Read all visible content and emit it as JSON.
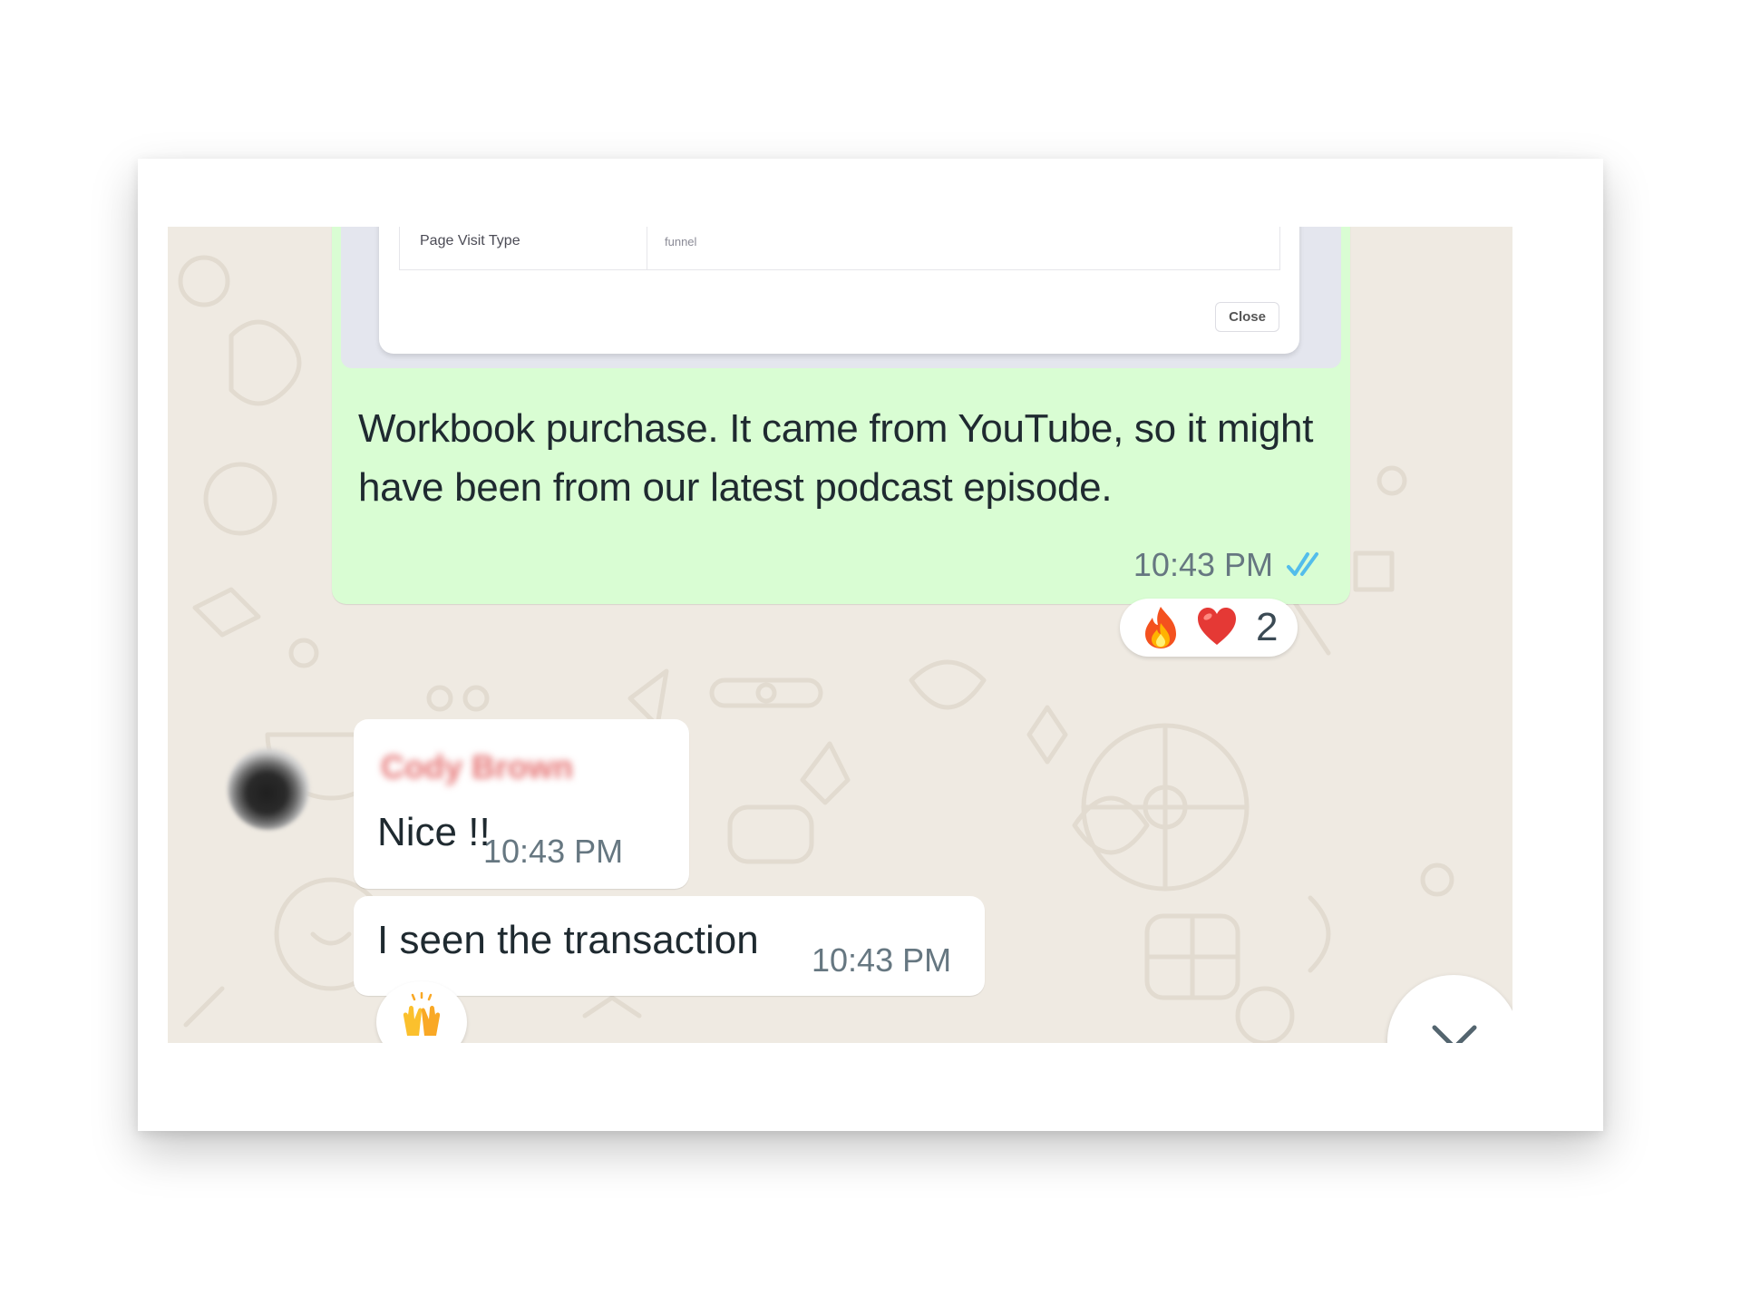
{
  "preview": {
    "row_label": "Page Visit Type",
    "row_value": "funnel",
    "close_label": "Close"
  },
  "outgoing": {
    "text": "Workbook purchase. It came from YouTube, so it might have been from our latest podcast episode.",
    "time": "10:43 PM",
    "status_icon": "double-check-icon",
    "reactions": {
      "emojis": [
        "fire-emoji",
        "red-heart-emoji"
      ],
      "count": "2"
    }
  },
  "incoming": {
    "sender": "Cody Brown",
    "messages": [
      {
        "text": "Nice !!",
        "time": "10:43 PM"
      },
      {
        "text": "I seen the transaction",
        "time": "10:43 PM",
        "reaction": "raising-hands-emoji"
      }
    ]
  },
  "scroll_button_icon": "chevron-down-icon",
  "colors": {
    "chat_background": "#efeae2",
    "outgoing_bubble": "#d9fdd3",
    "incoming_bubble": "#ffffff",
    "timestamp": "#667781",
    "read_ticks": "#53bdeb",
    "sender_name": "#e57373"
  }
}
